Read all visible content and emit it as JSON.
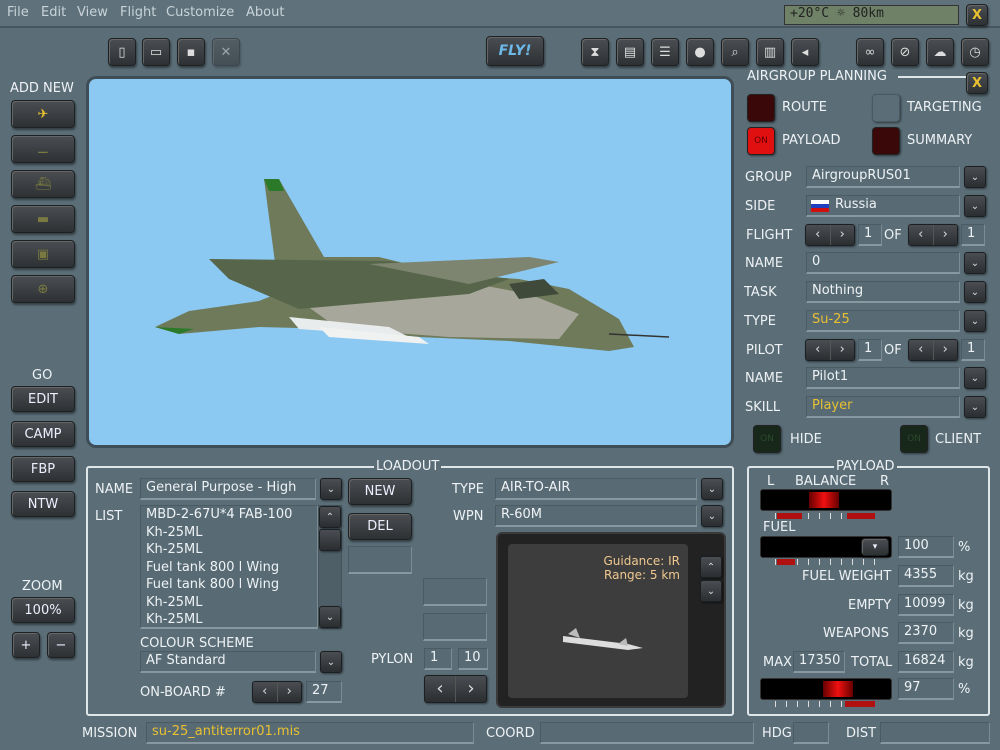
{
  "menu": [
    "File",
    "Edit",
    "View",
    "Flight",
    "Customize",
    "About"
  ],
  "weather": "+20°C ☼ 80km",
  "close_label": "X",
  "toolbar": {
    "fly": "FLY!",
    "file_icons": [
      "new-file-icon",
      "open-folder-icon",
      "save-icon",
      "close-file-icon"
    ],
    "tool_icons": [
      "hourglass-icon",
      "clipboard-icon",
      "list-icon",
      "head-icon",
      "search-icon",
      "book-icon",
      "speaker-icon"
    ],
    "right_icons": [
      "binoculars-icon",
      "no-icon",
      "weather-icon",
      "clock-icon"
    ]
  },
  "sidebar": {
    "add_new": "ADD NEW",
    "units": [
      "aircraft",
      "helicopter",
      "ship",
      "tank",
      "vehicle",
      "static"
    ],
    "go": "GO",
    "go_buttons": [
      "EDIT",
      "CAMP",
      "FBP",
      "NTW"
    ],
    "zoom": "ZOOM",
    "zoom_value": "100%",
    "zoom_in": "+",
    "zoom_out": "−"
  },
  "planning": {
    "title": "AIRGROUP PLANNING",
    "route": "ROUTE",
    "targeting": "TARGETING",
    "payload": "PAYLOAD",
    "summary": "SUMMARY",
    "on": "ON",
    "group_label": "GROUP",
    "group": "AirgroupRUS01",
    "side_label": "SIDE",
    "side": "Russia",
    "flight_label": "FLIGHT",
    "flight": "1",
    "of": "OF",
    "flight_total": "1",
    "name_label": "NAME",
    "name": "0",
    "task_label": "TASK",
    "task": "Nothing",
    "type_label": "TYPE",
    "type": "Su-25",
    "pilot_label": "PILOT",
    "pilot": "1",
    "pilot_total": "1",
    "pilot_name_label": "NAME",
    "pilot_name": "Pilot1",
    "skill_label": "SKILL",
    "skill": "Player",
    "hide": "HIDE",
    "client": "CLIENT"
  },
  "loadout": {
    "title": "LOADOUT",
    "name_label": "NAME",
    "name": "General Purpose - High",
    "new": "NEW",
    "del": "DEL",
    "list_label": "LIST",
    "list": [
      "MBD-2-67U*4 FAB-100",
      "Kh-25ML",
      "Kh-25ML",
      "Fuel tank 800 l Wing",
      "Fuel tank 800 l Wing",
      "Kh-25ML",
      "Kh-25ML"
    ],
    "colour_label": "COLOUR SCHEME",
    "colour": "AF Standard",
    "onboard_label": "ON-BOARD #",
    "onboard": "27",
    "type_label": "TYPE",
    "type": "AIR-TO-AIR",
    "wpn_label": "WPN",
    "wpn": "R-60M",
    "guidance": "Guidance: IR",
    "range": "Range: 5 km",
    "pylon_label": "PYLON",
    "pylon": "1",
    "pylon_total": "10"
  },
  "payload": {
    "title": "PAYLOAD",
    "l": "L",
    "balance": "BALANCE",
    "r": "R",
    "fuel_label": "FUEL",
    "fuel": "100",
    "pct": "%",
    "fuel_weight_label": "FUEL WEIGHT",
    "fuel_weight": "4355",
    "kg": "kg",
    "empty_label": "EMPTY",
    "empty": "10099",
    "weapons_label": "WEAPONS",
    "weapons": "2370",
    "max_label": "MAX",
    "max": "17350",
    "total_label": "TOTAL",
    "total": "16824",
    "load_pct": "97"
  },
  "status": {
    "mission_label": "MISSION",
    "mission": "su-25_antiterror01.mis",
    "coord_label": "COORD",
    "coord": "",
    "hdg_label": "HDG",
    "hdg": "",
    "dist_label": "DIST",
    "dist": ""
  }
}
